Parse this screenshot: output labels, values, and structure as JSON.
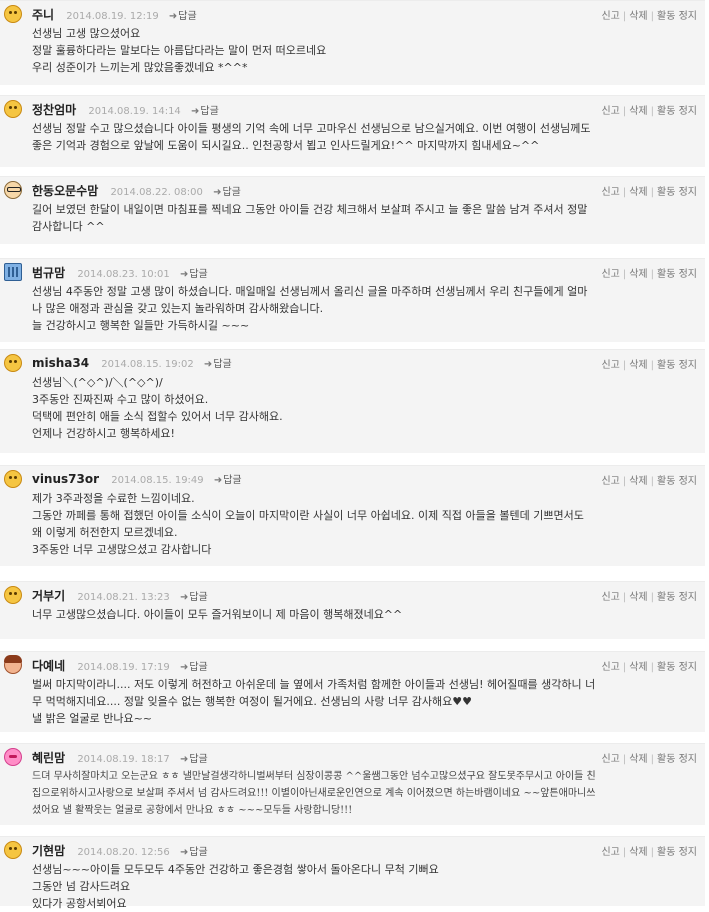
{
  "actions": {
    "report": "신고",
    "delete": "삭제",
    "suspend": "활동 정지"
  },
  "reply_label": "답글",
  "comments": [
    {
      "name": "주니",
      "date": "2014.08.19. 12:19",
      "avatar": "smiley-avatar",
      "lines": [
        "선생님 고생 많으셨어요",
        "정말 훌륭하다라는 말보다는 아름답다라는 말이 먼저 떠오르네요",
        "우리 성준이가 느끼는게 많았음좋겠네요 *^^*"
      ]
    },
    {
      "name": "정찬엄마",
      "date": "2014.08.19. 14:14",
      "avatar": "smiley-avatar",
      "lines": [
        "선생님 정말 수고 많으셨습니다 아이들 평생의 기억 속에 너무 고마우신 선생님으로 남으실거예요. 이번 여행이 선생님께도",
        "좋은 기억과 경험으로 앞날에 도움이 되시길요.. 인천공항서 뵙고 인사드릴게요!^^ 마지막까지 힘내세요~^^"
      ]
    },
    {
      "name": "한동오문수맘",
      "date": "2014.08.22. 08:00",
      "avatar": "glasses-avatar",
      "lines": [
        "길어 보였던 한달이 내일이면 마침표를 찍네요 그동안 아이들 건강 체크해서 보살펴 주시고 늘 좋은 말씀 남겨 주셔서 정말",
        "감사합니다 ^^"
      ]
    },
    {
      "name": "범규맘",
      "date": "2014.08.23. 10:01",
      "avatar": "building-avatar",
      "lines": [
        "선생님 4주동안 정말 고생 많이 하셨습니다. 매일매일 선생님께서 올리신 글을 마주하며 선생님께서 우리 친구들에게 얼마",
        "나 많은 애정과 관심을 갖고 있는지 놀라워하며 감사해왔습니다.",
        "늘 건강하시고 행복한 일들만 가득하시길 ~~~"
      ]
    },
    {
      "name": "misha34",
      "date": "2014.08.15. 19:02",
      "avatar": "smiley-avatar",
      "lines": [
        "선생님＼(^◇^)/＼(^◇^)/",
        "3주동안 진짜진짜 수고 많이 하셨어요.",
        "덕택에 편안히 애들 소식 접할수 있어서 너무 감사해요.",
        "언제나 건강하시고 행복하세요!"
      ]
    },
    {
      "name": "vinus73or",
      "date": "2014.08.15. 19:49",
      "avatar": "smiley-avatar",
      "lines": [
        "제가 3주과정을 수료한 느낌이네요.",
        "그동안 까페를 통해 접했던 아이들 소식이 오늘이 마지막이란 사실이 너무 아쉽네요. 이제 직접 아들을 볼텐데 기쁘면서도",
        "왜 이렇게 허전한지 모르겠네요.",
        "3주동안 너무 고생많으셨고 감사합니다"
      ]
    },
    {
      "name": "거부기",
      "date": "2014.08.21. 13:23",
      "avatar": "smiley-avatar",
      "lines": [
        "너무 고생많으셨습니다. 아이들이 모두 즐거워보이니 제 마음이 행복해졌네요^^"
      ]
    },
    {
      "name": "다예네",
      "date": "2014.08.19. 17:19",
      "avatar": "girl-avatar",
      "lines": [
        "벌써 마지막이라니.... 저도 이렇게 허전하고 아쉬운데 늘 옆에서 가족처럼 함께한 아이들과 선생님! 헤어질때를 생각하니 너",
        "무 먹먹해지네요.... 정말 잊을수 없는 행복한 여정이 될거에요. 선생님의 사랑 너무 감사해요♥♥",
        "낼 밝은 얼굴로 반나요~~"
      ]
    },
    {
      "name": "혜린맘",
      "date": "2014.08.19. 18:17",
      "avatar": "pink-avatar",
      "hand": true,
      "lines": [
        "드뎌 무사히잘마치고 오는군요 ㅎㅎ 낼만날걸생각하니벌써부터 심장이콩콩 ^^울쌤그동안 넘수고많으셨구요 잘도못주무시고 아이들 친",
        "집으로위하시고사랑으로 보살펴 주셔서 넘 감사드려요!!! 이별이아닌새로운인연으로 계속 이어졌으면 하는바램이네요 ~~앞튼애마니쓰",
        "셨어요 낼 활짝웃는 얼굴로 공항에서 만나요 ㅎㅎ ~~~모두들 사랑합니당!!!"
      ]
    },
    {
      "name": "기현맘",
      "date": "2014.08.20. 12:56",
      "avatar": "smiley-avatar",
      "lines": [
        "선생님~~~아이들 모두모두 4주동안 건강하고 좋은경험 쌓아서 돌아온다니 무척 기뻐요",
        "그동안 넘 감사드려요",
        "있다가 공항서뵈어요"
      ]
    }
  ]
}
